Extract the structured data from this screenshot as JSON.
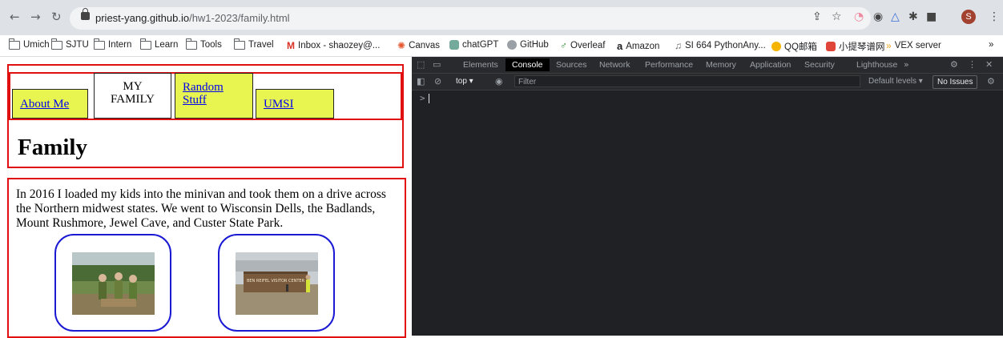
{
  "browser": {
    "url_host": "priest-yang.github.io",
    "url_path": "/hw1-2023/family.html",
    "profile_initial": "S"
  },
  "bookmarks": [
    {
      "label": "Umich",
      "type": "folder"
    },
    {
      "label": "SJTU",
      "type": "folder"
    },
    {
      "label": "Intern",
      "type": "folder"
    },
    {
      "label": "Learn",
      "type": "folder"
    },
    {
      "label": "Tools",
      "type": "folder"
    },
    {
      "label": "Travel",
      "type": "folder"
    },
    {
      "label": "Inbox - shaozey@...",
      "type": "gmail"
    },
    {
      "label": "Canvas",
      "type": "canvas"
    },
    {
      "label": "chatGPT",
      "type": "chatgpt"
    },
    {
      "label": "GitHub",
      "type": "github"
    },
    {
      "label": "Overleaf",
      "type": "overleaf"
    },
    {
      "label": "Amazon",
      "type": "amazon"
    },
    {
      "label": "SI 664 PythonAny...",
      "type": "python"
    },
    {
      "label": "QQ邮箱",
      "type": "qq"
    },
    {
      "label": "小提琴谱网",
      "type": "violin"
    },
    {
      "label": "VEX server",
      "type": "vex"
    }
  ],
  "page": {
    "nav": {
      "about": "About Me",
      "family_line1": "MY",
      "family_line2": "FAMILY",
      "random_line1": "Random",
      "random_line2": "Stuff",
      "umsi": "UMSI"
    },
    "title": "Family",
    "paragraph": "In 2016 I loaded my kids into the minivan and took them on a drive across the Northern midwest states. We went to Wisconsin Dells, the Badlands, Mount Rushmore, Jewel Cave, and Custer State Park.",
    "photo2_sign": "BEN REIFEL VISITOR CENTER"
  },
  "devtools": {
    "tabs": [
      "Elements",
      "Console",
      "Sources",
      "Network",
      "Performance",
      "Memory",
      "Application",
      "Security",
      "Lighthouse"
    ],
    "active_tab": "Console",
    "context": "top",
    "filter_placeholder": "Filter",
    "levels": "Default levels",
    "issues": "No Issues",
    "prompt": ">"
  },
  "colors": {
    "border_red": "#e01010",
    "nav_yellow": "#e8f550",
    "frame_blue": "#1a1ad4"
  }
}
